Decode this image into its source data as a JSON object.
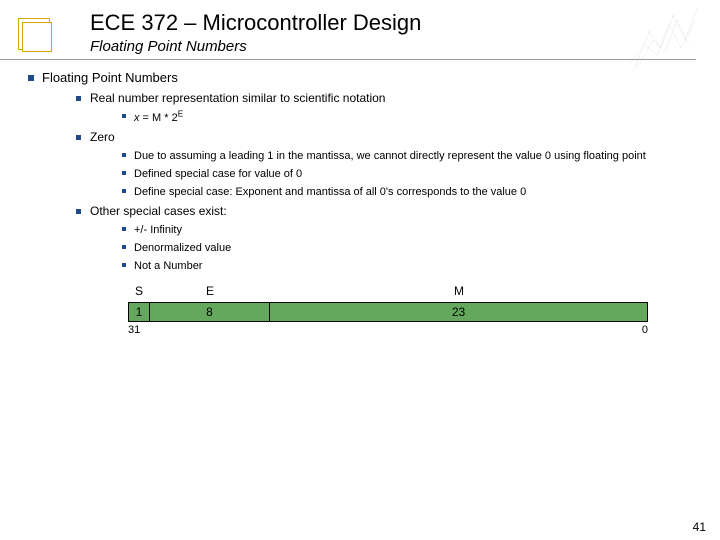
{
  "header": {
    "title": "ECE 372 – Microcontroller Design",
    "subtitle": "Floating Point Numbers"
  },
  "content": {
    "heading": "Floating Point Numbers",
    "item1": {
      "label": "Real number representation similar to scientific notation",
      "formula_x": "x",
      "formula_eq": " = M * 2",
      "formula_exp": "E"
    },
    "item2": {
      "label": "Zero",
      "sub1": "Due to assuming a leading 1 in the mantissa, we cannot directly represent the value 0 using floating point",
      "sub2": "Defined special case for value of 0",
      "sub3": "Define special case: Exponent and mantissa of all 0's corresponds to the value 0"
    },
    "item3": {
      "label": "Other special cases exist:",
      "sub1": "+/- Infinity",
      "sub2": "Denormalized value",
      "sub3": "Not a Number"
    }
  },
  "diagram": {
    "labels": {
      "s": "S",
      "e": "E",
      "m": "M"
    },
    "widths": {
      "s": "1",
      "e": "8",
      "m": "23"
    },
    "bit_hi": "31",
    "bit_lo": "0"
  },
  "page_number": "41"
}
